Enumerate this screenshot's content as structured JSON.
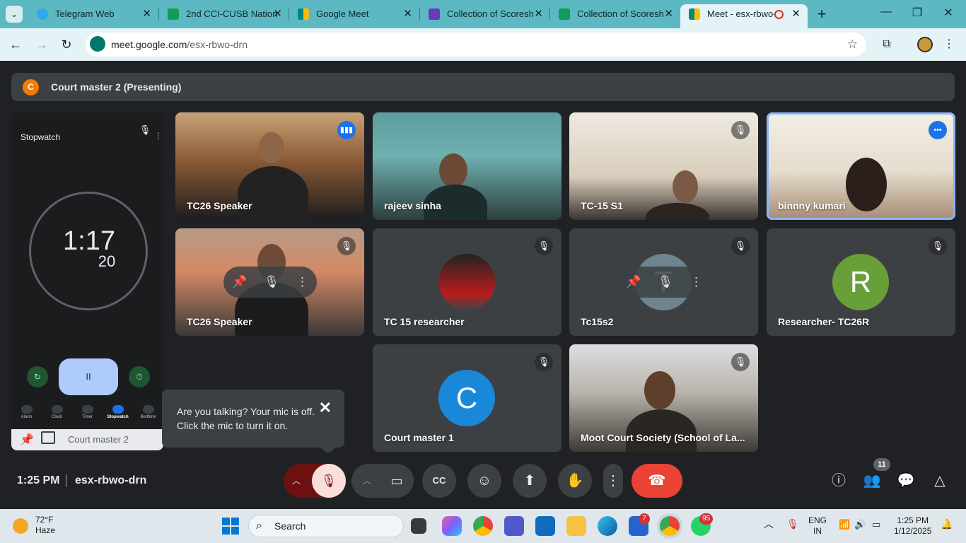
{
  "browser": {
    "tabs": [
      {
        "label": "Telegram Web",
        "icon": "telegram-icon",
        "color": "#2aabee"
      },
      {
        "label": "2nd CCI-CUSB Nation",
        "icon": "sheets-icon",
        "color": "#0f9d58"
      },
      {
        "label": "Google Meet",
        "icon": "meet-icon",
        "color": "#00897b"
      },
      {
        "label": "Collection of Scoresh",
        "icon": "forms-icon",
        "color": "#673ab7"
      },
      {
        "label": "Collection of Scoresh",
        "icon": "sheets-icon",
        "color": "#0f9d58"
      },
      {
        "label": "Meet - esx-rbwo-",
        "icon": "meet-icon",
        "color": "#00897b"
      }
    ],
    "url_host": "meet.google.com",
    "url_path": "/esx-rbwo-drn"
  },
  "banner": {
    "avatar_letter": "C",
    "title": "Court master 2 (Presenting)"
  },
  "presentation": {
    "app_title": "Stopwatch",
    "time_main": "1:17",
    "time_sub": "20",
    "pause_glyph": "II",
    "tabs": [
      "Alarm",
      "Clock",
      "Timer",
      "Stopwatch",
      "Bedtime"
    ],
    "selected_tab": "Stopwatch",
    "footer": "Court master 2"
  },
  "participants": [
    {
      "name": "TC26 Speaker",
      "state": "speaking",
      "type": "video"
    },
    {
      "name": "rajeev sinha",
      "state": "",
      "type": "video"
    },
    {
      "name": "TC-15 S1",
      "state": "muted",
      "type": "video"
    },
    {
      "name": "binnny kumari",
      "state": "pinned-highlight",
      "type": "video"
    },
    {
      "name": "TC26 Speaker",
      "state": "muted",
      "type": "video"
    },
    {
      "name": "TC 15 researcher",
      "state": "muted",
      "type": "photo"
    },
    {
      "name": "Tc15s2",
      "state": "muted",
      "type": "avatar",
      "letter": "T",
      "avatar_color": "#6f8490"
    },
    {
      "name": "Researcher- TC26R",
      "state": "muted",
      "type": "avatar",
      "letter": "R",
      "avatar_color": "#689f38"
    },
    {
      "name": "Court master 1",
      "state": "muted",
      "type": "avatar",
      "letter": "C",
      "avatar_color": "#1a88d9"
    },
    {
      "name": "Moot Court Society (School of La...",
      "state": "muted",
      "type": "video"
    }
  ],
  "tooltip": {
    "text": "Are you talking? Your mic is off. Click the mic to turn it on."
  },
  "meeting": {
    "time": "1:25 PM",
    "code": "esx-rbwo-drn",
    "participant_count": "11"
  },
  "taskbar": {
    "weather_temp": "72°F",
    "weather_desc": "Haze",
    "search_placeholder": "Search",
    "teams_badge": "7",
    "whatsapp_badge": "95",
    "lang_top": "ENG",
    "lang_bottom": "IN",
    "clock_time": "1:25 PM",
    "clock_date": "1/12/2025"
  }
}
